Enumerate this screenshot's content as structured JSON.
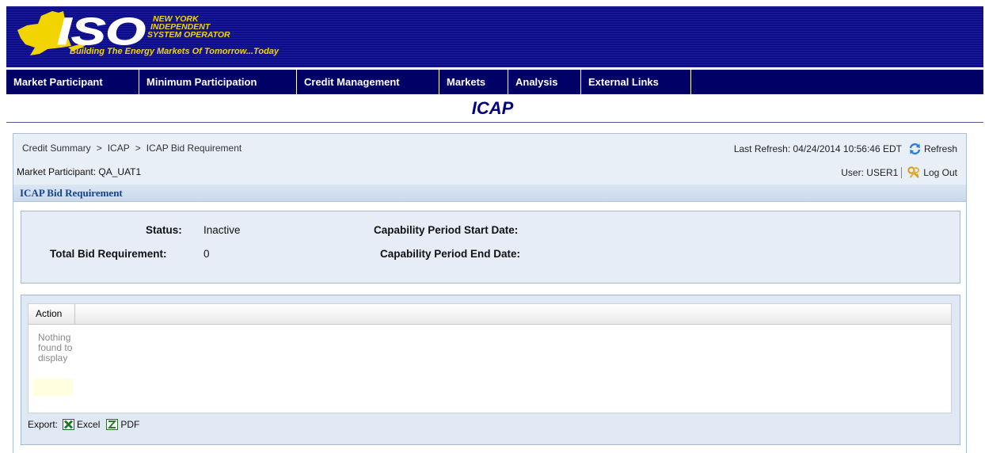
{
  "banner": {
    "org_line1": "NEW YORK",
    "org_line2": "INDEPENDENT",
    "org_line3": "SYSTEM OPERATOR",
    "logo_text": "ISO",
    "tagline": "Building The Energy Markets Of Tomorrow...Today",
    "colors": {
      "background": "#0d0d8c",
      "logo_yellow": "#f2d400"
    }
  },
  "nav": {
    "items": [
      {
        "label": "Market Participant"
      },
      {
        "label": "Minimum Participation"
      },
      {
        "label": "Credit Management"
      },
      {
        "label": "Markets"
      },
      {
        "label": "Analysis"
      },
      {
        "label": "External Links"
      }
    ]
  },
  "page_title": "ICAP",
  "header": {
    "breadcrumb": [
      "Credit Summary",
      "ICAP",
      "ICAP Bid Requirement"
    ],
    "breadcrumb_separator": ">",
    "market_participant_label": "Market Participant:",
    "market_participant_value": "QA_UAT1",
    "last_refresh_label": "Last Refresh:",
    "last_refresh_value": "04/24/2014 10:56:46 EDT",
    "refresh_label": "Refresh",
    "user_label": "User:",
    "user_value": "USER1",
    "logout_label": "Log Out",
    "icons": {
      "refresh": "refresh-icon",
      "logout": "keys-icon"
    }
  },
  "section": {
    "title": "ICAP Bid Requirement"
  },
  "details": {
    "status_label": "Status:",
    "status_value": "Inactive",
    "total_bid_label": "Total Bid Requirement:",
    "total_bid_value": "0",
    "cap_start_label": "Capability Period Start Date:",
    "cap_start_value": "",
    "cap_end_label": "Capability Period End Date:",
    "cap_end_value": ""
  },
  "grid": {
    "columns": [
      "Action"
    ],
    "empty_message": "Nothing found to display",
    "export_label": "Export:",
    "export_excel": "Excel",
    "export_pdf": "PDF",
    "icons": {
      "excel": "excel-icon",
      "pdf": "pdf-icon"
    }
  }
}
